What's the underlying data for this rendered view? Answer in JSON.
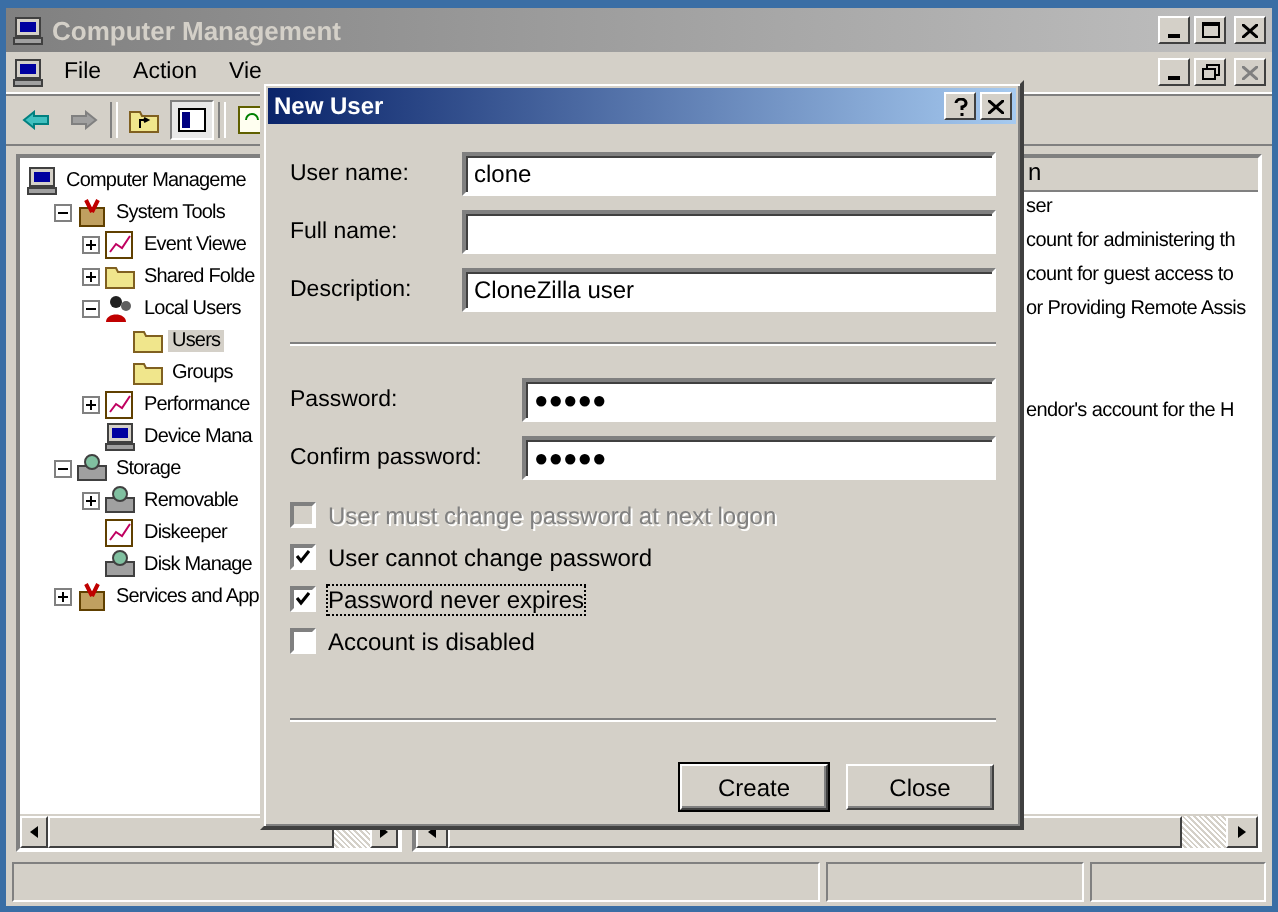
{
  "window": {
    "title": "Computer Management"
  },
  "menu": [
    "File",
    "Action",
    "Vie"
  ],
  "tree": [
    {
      "label": "Computer Manageme",
      "kind": "computer",
      "selected": false,
      "children": [
        {
          "label": "System Tools",
          "kind": "tools",
          "expanded": true,
          "selected": false,
          "children": [
            {
              "label": "Event Viewe",
              "kind": "node",
              "expanded": false,
              "selected": false
            },
            {
              "label": "Shared Folde",
              "kind": "folder",
              "expanded": false,
              "selected": false
            },
            {
              "label": "Local Users",
              "kind": "users",
              "expanded": true,
              "selected": false,
              "children": [
                {
                  "label": "Users",
                  "kind": "folder",
                  "selected": true
                },
                {
                  "label": "Groups",
                  "kind": "folder",
                  "selected": false
                }
              ]
            },
            {
              "label": "Performance",
              "kind": "node",
              "expanded": false,
              "selected": false
            },
            {
              "label": "Device Mana",
              "kind": "computer",
              "selected": false
            }
          ]
        },
        {
          "label": "Storage",
          "kind": "disk",
          "expanded": true,
          "selected": false,
          "children": [
            {
              "label": "Removable",
              "kind": "disk",
              "expanded": false,
              "selected": false
            },
            {
              "label": "Diskeeper",
              "kind": "node",
              "selected": false
            },
            {
              "label": "Disk Manage",
              "kind": "disk",
              "selected": false
            }
          ]
        },
        {
          "label": "Services and App",
          "kind": "tools",
          "expanded": false,
          "selected": false
        }
      ]
    }
  ],
  "list": {
    "column": "n",
    "rows": [
      {
        "description": "ser"
      },
      {
        "description": "count for administering th"
      },
      {
        "description": "count for guest access to"
      },
      {
        "description": "or Providing Remote Assis"
      },
      {},
      {},
      {
        "description": "endor's account for the H"
      }
    ]
  },
  "dialog": {
    "title": "New User",
    "fields": [
      {
        "label": "User name:",
        "value": "clone"
      },
      {
        "label": "Full name:"
      },
      {
        "label": "Description:",
        "value": "CloneZilla user"
      }
    ],
    "passwords": [
      {
        "label": "Password:",
        "value": "●●●●●"
      },
      {
        "label": "Confirm password:",
        "value": "●●●●●"
      }
    ],
    "options": [
      {
        "label": "User must change password at next logon",
        "checked": false,
        "disabled": true,
        "focused": false
      },
      {
        "label": "User cannot change password",
        "checked": true,
        "disabled": false,
        "focused": false
      },
      {
        "label": "Password never expires",
        "checked": true,
        "disabled": false,
        "focused": true
      },
      {
        "label": "Account is disabled",
        "checked": false,
        "disabled": false,
        "focused": false
      }
    ],
    "buttons": [
      {
        "label": "Create",
        "default": true
      },
      {
        "label": "Close",
        "default": false
      }
    ]
  }
}
